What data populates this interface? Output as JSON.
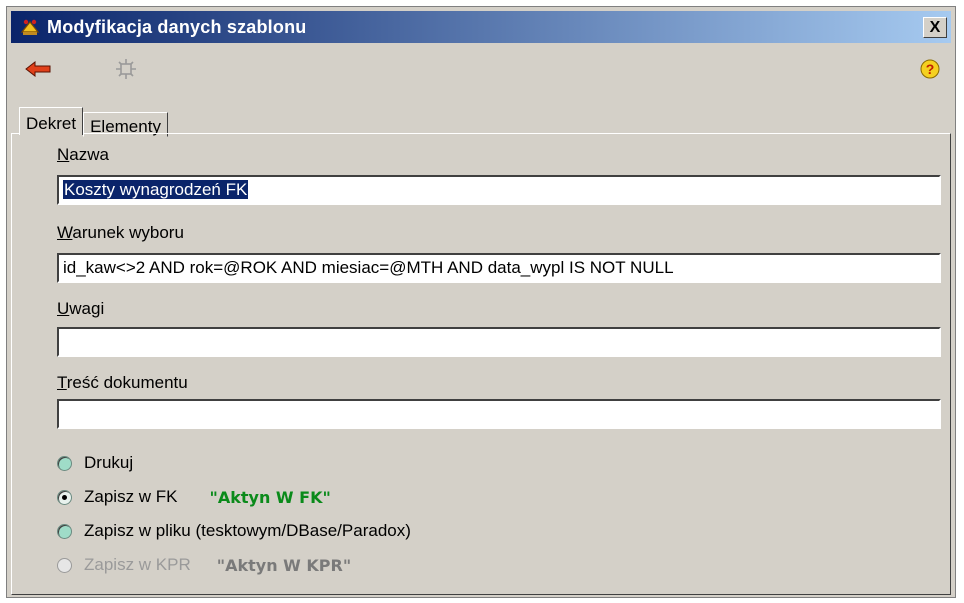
{
  "window": {
    "title": "Modyfikacja danych szablonu",
    "close_label": "X"
  },
  "toolbar": {
    "back_icon": "back-arrow-icon",
    "tool_icon": "gear-icon",
    "help_icon": "help-icon"
  },
  "tabs": [
    {
      "label": "Dekret"
    },
    {
      "label": "Elementy"
    }
  ],
  "fields": {
    "nazwa": {
      "label_hotkey": "N",
      "label_rest": "azwa",
      "value": "Koszty wynagrodzeń FK"
    },
    "warunek": {
      "label_hotkey": "W",
      "label_rest": "arunek wyboru",
      "value": "id_kaw<>2 AND rok=@ROK AND miesiac=@MTH AND data_wypl IS NOT NULL"
    },
    "uwagi": {
      "label_hotkey": "U",
      "label_rest": "wagi",
      "value": ""
    },
    "tresc": {
      "label_hotkey": "T",
      "label_rest": "reść dokumentu",
      "value": ""
    }
  },
  "options": [
    {
      "label": "Drukuj",
      "checked": false,
      "disabled": false,
      "tag": ""
    },
    {
      "label": "Zapisz w FK",
      "checked": true,
      "disabled": false,
      "tag": "\"Aktyn W FK\""
    },
    {
      "label": "Zapisz w pliku (tesktowym/DBase/Paradox)",
      "checked": false,
      "disabled": false,
      "tag": ""
    },
    {
      "label": "Zapisz w KPR",
      "checked": false,
      "disabled": true,
      "tag": "\"Aktyn W KPR\""
    }
  ],
  "colors": {
    "titlebar_start": "#0a246a",
    "titlebar_end": "#a6caf0",
    "tag_green": "#0a8a1a",
    "tag_grey": "#7a7a7a"
  }
}
